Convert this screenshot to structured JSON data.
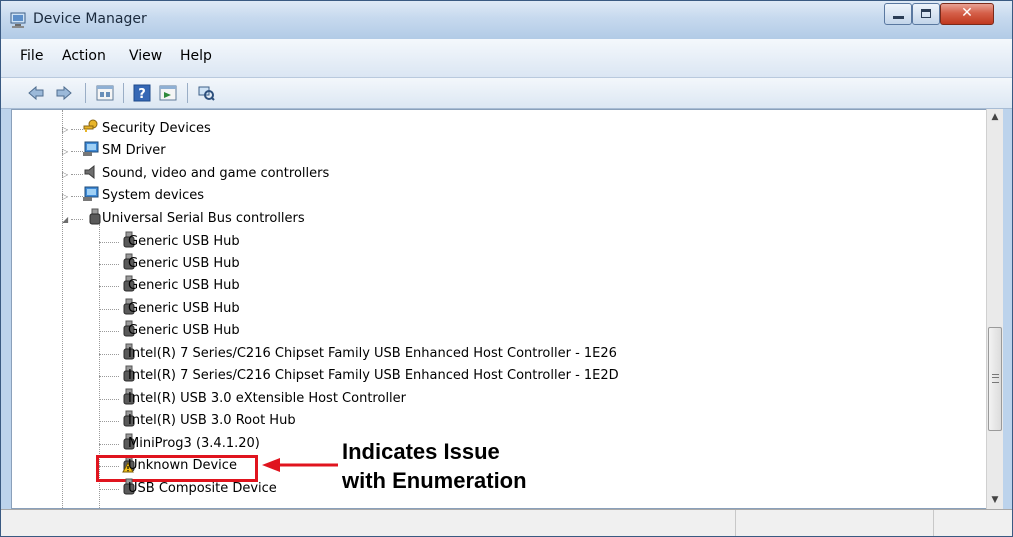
{
  "window": {
    "title": "Device Manager"
  },
  "menu": [
    "File",
    "Action",
    "View",
    "Help"
  ],
  "toolbar": [
    "back-icon",
    "forward-icon",
    "properties-icon",
    "help-icon",
    "update-driver-icon",
    "scan-hardware-icon"
  ],
  "tree": {
    "categories": [
      {
        "label": "Security Devices",
        "icon": "key-icon",
        "expanded": false
      },
      {
        "label": "SM Driver",
        "icon": "computer-icon",
        "expanded": false
      },
      {
        "label": "Sound, video and game controllers",
        "icon": "speaker-icon",
        "expanded": false
      },
      {
        "label": "System devices",
        "icon": "computer-icon",
        "expanded": false
      },
      {
        "label": "Universal Serial Bus controllers",
        "icon": "usb-icon",
        "expanded": true
      }
    ],
    "usb_children": [
      {
        "label": "Generic USB Hub",
        "icon": "usb-icon"
      },
      {
        "label": "Generic USB Hub",
        "icon": "usb-icon"
      },
      {
        "label": "Generic USB Hub",
        "icon": "usb-icon"
      },
      {
        "label": "Generic USB Hub",
        "icon": "usb-icon"
      },
      {
        "label": "Generic USB Hub",
        "icon": "usb-icon"
      },
      {
        "label": "Intel(R) 7 Series/C216 Chipset Family USB Enhanced Host Controller - 1E26",
        "icon": "usb-icon"
      },
      {
        "label": "Intel(R) 7 Series/C216 Chipset Family USB Enhanced Host Controller - 1E2D",
        "icon": "usb-icon"
      },
      {
        "label": "Intel(R) USB 3.0 eXtensible Host Controller",
        "icon": "usb-icon"
      },
      {
        "label": "Intel(R) USB 3.0 Root Hub",
        "icon": "usb-icon"
      },
      {
        "label": "MiniProg3 (3.4.1.20)",
        "icon": "usb-icon"
      },
      {
        "label": "Unknown Device",
        "icon": "warning-usb-icon"
      },
      {
        "label": "USB Composite Device",
        "icon": "usb-icon"
      }
    ]
  },
  "annotation": {
    "line1": "Indicates Issue",
    "line2": "with Enumeration",
    "color": "#e0141e"
  },
  "colors": {
    "title_bar": "#c6d9ee",
    "window_frame": "#bcd3ec",
    "close_button": "#c0391f"
  }
}
